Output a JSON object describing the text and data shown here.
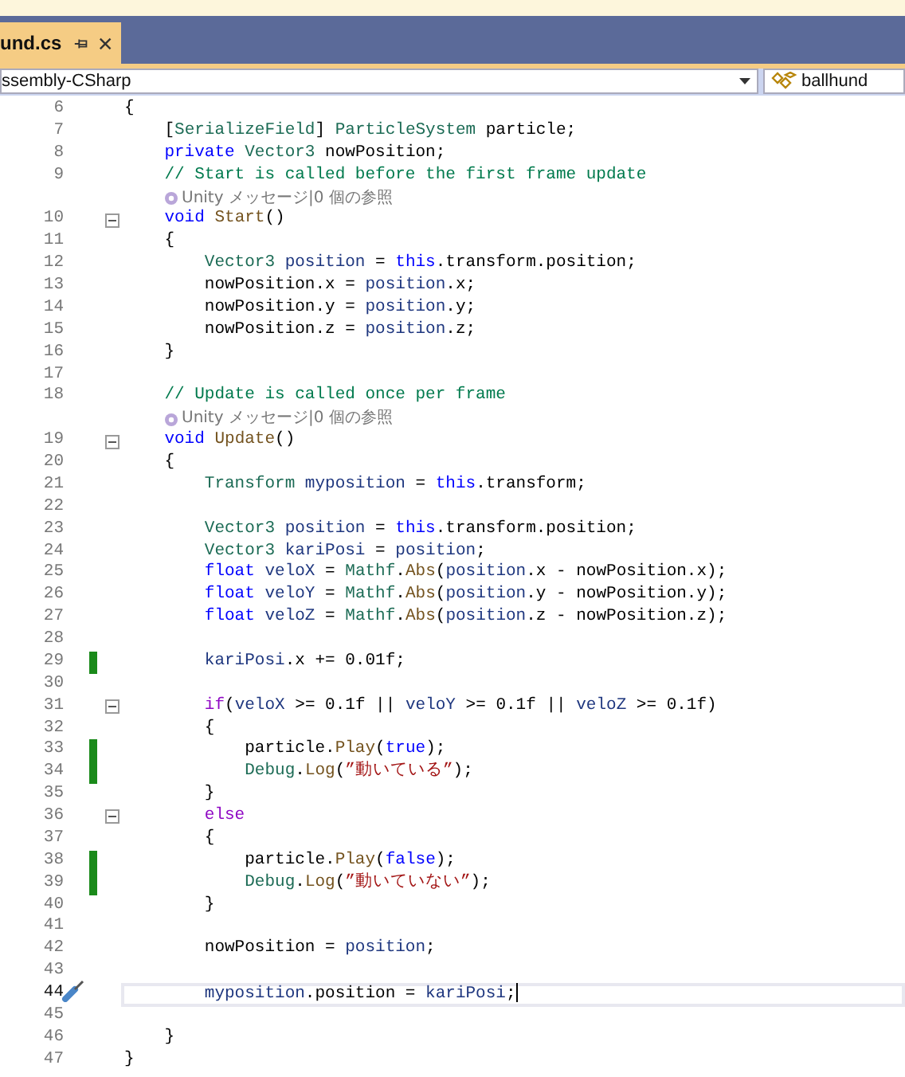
{
  "tab": {
    "label": "und.cs",
    "selected": true
  },
  "nav": {
    "project": "ssembly-CSharp",
    "class_name": "ballhund"
  },
  "lines": [
    {
      "kind": "code",
      "number": "6",
      "tokens": [
        {
          "kind": "plain",
          "text": "{"
        }
      ]
    },
    {
      "kind": "code",
      "number": "7",
      "tokens": [
        {
          "kind": "plain",
          "text": "    ["
        },
        {
          "kind": "type",
          "text": "SerializeField"
        },
        {
          "kind": "plain",
          "text": "] "
        },
        {
          "kind": "type",
          "text": "ParticleSystem"
        },
        {
          "kind": "plain",
          "text": " particle;"
        }
      ]
    },
    {
      "kind": "code",
      "number": "8",
      "tokens": [
        {
          "kind": "keyword",
          "text": "    private"
        },
        {
          "kind": "type",
          "text": " Vector3"
        },
        {
          "kind": "plain",
          "text": " nowPosition;"
        }
      ]
    },
    {
      "kind": "code",
      "number": "9",
      "tokens": [
        {
          "kind": "comment",
          "text": "    // Start is called before the first frame update"
        }
      ]
    },
    {
      "kind": "lens",
      "text": "Unity メッセージ|0 個の参照"
    },
    {
      "kind": "code",
      "number": "10",
      "expanded": true,
      "tokens": [
        {
          "kind": "keyword",
          "text": "    void"
        },
        {
          "kind": "method",
          "text": " Start"
        },
        {
          "kind": "plain",
          "text": "()"
        }
      ]
    },
    {
      "kind": "code",
      "number": "11",
      "tokens": [
        {
          "kind": "plain",
          "text": "    {"
        }
      ]
    },
    {
      "kind": "code",
      "number": "12",
      "tokens": [
        {
          "kind": "type",
          "text": "        Vector3"
        },
        {
          "kind": "variable",
          "text": " position"
        },
        {
          "kind": "plain",
          "text": " = "
        },
        {
          "kind": "keyword",
          "text": "this"
        },
        {
          "kind": "plain",
          "text": ".transform.position;"
        }
      ]
    },
    {
      "kind": "code",
      "number": "13",
      "tokens": [
        {
          "kind": "plain",
          "text": "        nowPosition.x = "
        },
        {
          "kind": "variable",
          "text": "position"
        },
        {
          "kind": "plain",
          "text": ".x;"
        }
      ]
    },
    {
      "kind": "code",
      "number": "14",
      "tokens": [
        {
          "kind": "plain",
          "text": "        nowPosition.y = "
        },
        {
          "kind": "variable",
          "text": "position"
        },
        {
          "kind": "plain",
          "text": ".y;"
        }
      ]
    },
    {
      "kind": "code",
      "number": "15",
      "tokens": [
        {
          "kind": "plain",
          "text": "        nowPosition.z = "
        },
        {
          "kind": "variable",
          "text": "position"
        },
        {
          "kind": "plain",
          "text": ".z;"
        }
      ]
    },
    {
      "kind": "code",
      "number": "16",
      "tokens": [
        {
          "kind": "plain",
          "text": "    }"
        }
      ]
    },
    {
      "kind": "code",
      "number": "17"
    },
    {
      "kind": "code",
      "number": "18",
      "tokens": [
        {
          "kind": "comment",
          "text": "    // Update is called once per frame"
        }
      ]
    },
    {
      "kind": "lens",
      "text": "Unity メッセージ|0 個の参照"
    },
    {
      "kind": "code",
      "number": "19",
      "expanded": true,
      "tokens": [
        {
          "kind": "keyword",
          "text": "    void"
        },
        {
          "kind": "method",
          "text": " Update"
        },
        {
          "kind": "plain",
          "text": "()"
        }
      ]
    },
    {
      "kind": "code",
      "number": "20",
      "tokens": [
        {
          "kind": "plain",
          "text": "    {"
        }
      ]
    },
    {
      "kind": "code",
      "number": "21",
      "tokens": [
        {
          "kind": "type",
          "text": "        Transform"
        },
        {
          "kind": "variable",
          "text": " myposition"
        },
        {
          "kind": "plain",
          "text": " = "
        },
        {
          "kind": "keyword",
          "text": "this"
        },
        {
          "kind": "plain",
          "text": ".transform;"
        }
      ]
    },
    {
      "kind": "code",
      "number": "22"
    },
    {
      "kind": "code",
      "number": "23",
      "tokens": [
        {
          "kind": "type",
          "text": "        Vector3"
        },
        {
          "kind": "variable",
          "text": " position"
        },
        {
          "kind": "plain",
          "text": " = "
        },
        {
          "kind": "keyword",
          "text": "this"
        },
        {
          "kind": "plain",
          "text": ".transform.position;"
        }
      ]
    },
    {
      "kind": "code",
      "number": "24",
      "tokens": [
        {
          "kind": "type",
          "text": "        Vector3"
        },
        {
          "kind": "variable",
          "text": " kariPosi"
        },
        {
          "kind": "plain",
          "text": " = "
        },
        {
          "kind": "variable",
          "text": "position"
        },
        {
          "kind": "plain",
          "text": ";"
        }
      ]
    },
    {
      "kind": "code",
      "number": "25",
      "tokens": [
        {
          "kind": "keyword",
          "text": "        float"
        },
        {
          "kind": "variable",
          "text": " veloX"
        },
        {
          "kind": "plain",
          "text": " = "
        },
        {
          "kind": "type",
          "text": "Mathf"
        },
        {
          "kind": "plain",
          "text": "."
        },
        {
          "kind": "method",
          "text": "Abs"
        },
        {
          "kind": "plain",
          "text": "("
        },
        {
          "kind": "variable",
          "text": "position"
        },
        {
          "kind": "plain",
          "text": ".x - nowPosition.x);"
        }
      ]
    },
    {
      "kind": "code",
      "number": "26",
      "tokens": [
        {
          "kind": "keyword",
          "text": "        float"
        },
        {
          "kind": "variable",
          "text": " veloY"
        },
        {
          "kind": "plain",
          "text": " = "
        },
        {
          "kind": "type",
          "text": "Mathf"
        },
        {
          "kind": "plain",
          "text": "."
        },
        {
          "kind": "method",
          "text": "Abs"
        },
        {
          "kind": "plain",
          "text": "("
        },
        {
          "kind": "variable",
          "text": "position"
        },
        {
          "kind": "plain",
          "text": ".y - nowPosition.y);"
        }
      ]
    },
    {
      "kind": "code",
      "number": "27",
      "tokens": [
        {
          "kind": "keyword",
          "text": "        float"
        },
        {
          "kind": "variable",
          "text": " veloZ"
        },
        {
          "kind": "plain",
          "text": " = "
        },
        {
          "kind": "type",
          "text": "Mathf"
        },
        {
          "kind": "plain",
          "text": "."
        },
        {
          "kind": "method",
          "text": "Abs"
        },
        {
          "kind": "plain",
          "text": "("
        },
        {
          "kind": "variable",
          "text": "position"
        },
        {
          "kind": "plain",
          "text": ".z - nowPosition.z);"
        }
      ]
    },
    {
      "kind": "code",
      "number": "28"
    },
    {
      "kind": "code",
      "number": "29",
      "modified": true,
      "tokens": [
        {
          "kind": "variable",
          "text": "        kariPosi"
        },
        {
          "kind": "plain",
          "text": ".x += 0.01f;"
        }
      ]
    },
    {
      "kind": "code",
      "number": "30"
    },
    {
      "kind": "code",
      "number": "31",
      "expanded": true,
      "tokens": [
        {
          "kind": "control",
          "text": "        if"
        },
        {
          "kind": "plain",
          "text": "("
        },
        {
          "kind": "variable",
          "text": "veloX"
        },
        {
          "kind": "plain",
          "text": " >= 0.1f || "
        },
        {
          "kind": "variable",
          "text": "veloY"
        },
        {
          "kind": "plain",
          "text": " >= 0.1f || "
        },
        {
          "kind": "variable",
          "text": "veloZ"
        },
        {
          "kind": "plain",
          "text": " >= 0.1f)"
        }
      ]
    },
    {
      "kind": "code",
      "number": "32",
      "tokens": [
        {
          "kind": "plain",
          "text": "        {"
        }
      ]
    },
    {
      "kind": "code",
      "number": "33",
      "modified": true,
      "tokens": [
        {
          "kind": "plain",
          "text": "            particle."
        },
        {
          "kind": "method",
          "text": "Play"
        },
        {
          "kind": "plain",
          "text": "("
        },
        {
          "kind": "keyword",
          "text": "true"
        },
        {
          "kind": "plain",
          "text": ");"
        }
      ]
    },
    {
      "kind": "code",
      "number": "34",
      "modified": true,
      "tokens": [
        {
          "kind": "type",
          "text": "            Debug"
        },
        {
          "kind": "plain",
          "text": "."
        },
        {
          "kind": "method",
          "text": "Log"
        },
        {
          "kind": "plain",
          "text": "("
        },
        {
          "kind": "string",
          "text": "”動いている”"
        },
        {
          "kind": "plain",
          "text": ");"
        }
      ]
    },
    {
      "kind": "code",
      "number": "35",
      "tokens": [
        {
          "kind": "plain",
          "text": "        }"
        }
      ]
    },
    {
      "kind": "code",
      "number": "36",
      "expanded": true,
      "tokens": [
        {
          "kind": "control",
          "text": "        else"
        }
      ]
    },
    {
      "kind": "code",
      "number": "37",
      "tokens": [
        {
          "kind": "plain",
          "text": "        {"
        }
      ]
    },
    {
      "kind": "code",
      "number": "38",
      "modified": true,
      "tokens": [
        {
          "kind": "plain",
          "text": "            particle."
        },
        {
          "kind": "method",
          "text": "Play"
        },
        {
          "kind": "plain",
          "text": "("
        },
        {
          "kind": "keyword",
          "text": "false"
        },
        {
          "kind": "plain",
          "text": ");"
        }
      ]
    },
    {
      "kind": "code",
      "number": "39",
      "modified": true,
      "tokens": [
        {
          "kind": "type",
          "text": "            Debug"
        },
        {
          "kind": "plain",
          "text": "."
        },
        {
          "kind": "method",
          "text": "Log"
        },
        {
          "kind": "plain",
          "text": "("
        },
        {
          "kind": "string",
          "text": "”動いていない”"
        },
        {
          "kind": "plain",
          "text": ");"
        }
      ]
    },
    {
      "kind": "code",
      "number": "40",
      "tokens": [
        {
          "kind": "plain",
          "text": "        }"
        }
      ]
    },
    {
      "kind": "code",
      "number": "41"
    },
    {
      "kind": "code",
      "number": "42",
      "tokens": [
        {
          "kind": "plain",
          "text": "        nowPosition = "
        },
        {
          "kind": "variable",
          "text": "position"
        },
        {
          "kind": "plain",
          "text": ";"
        }
      ]
    },
    {
      "kind": "code",
      "number": "43"
    },
    {
      "kind": "code",
      "number": "44",
      "current": true,
      "tokens": [
        {
          "kind": "variable",
          "text": "        myposition"
        },
        {
          "kind": "plain",
          "text": ".position = "
        },
        {
          "kind": "variable",
          "text": "kariPosi"
        },
        {
          "kind": "plain",
          "text": ";"
        }
      ]
    },
    {
      "kind": "code",
      "number": "45"
    },
    {
      "kind": "code",
      "number": "46",
      "tokens": [
        {
          "kind": "plain",
          "text": "    }"
        }
      ]
    },
    {
      "kind": "code",
      "number": "47",
      "tokens": [
        {
          "kind": "plain",
          "text": "}"
        }
      ]
    }
  ]
}
